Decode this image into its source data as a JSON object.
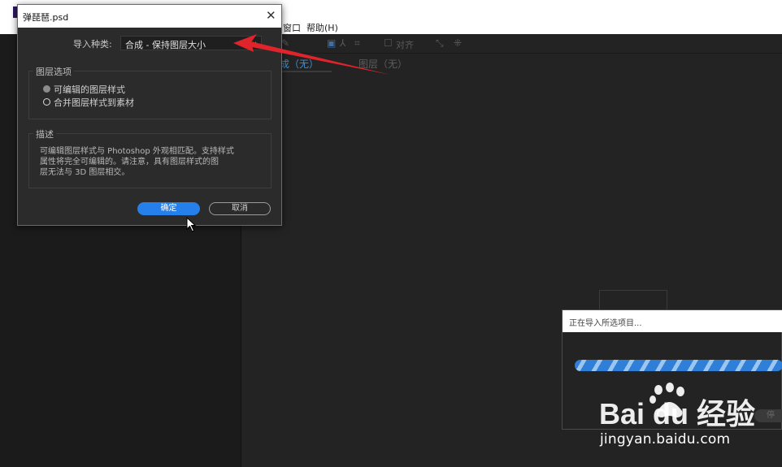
{
  "menubar": {
    "window_menu": "窗口",
    "help_menu": "帮助(H)"
  },
  "toolbar": {
    "align_label": "对齐"
  },
  "viewer_tabs": {
    "composition_tab": "成（无）",
    "layer_tab": "图层（无）"
  },
  "import_dialog": {
    "title": "弹琵琶.psd",
    "close_glyph": "✕",
    "import_kind_label": "导入种类:",
    "import_kind_value": "合成 - 保持图层大小",
    "layer_options_title": "图层选项",
    "options": [
      {
        "label": "可编辑的图层样式",
        "selected": true
      },
      {
        "label": "合并图层样式到素材",
        "selected": false
      }
    ],
    "description_title": "描述",
    "description_lines": [
      "可编辑图层样式与 Photoshop 外观相匹配。支持样式",
      "属性将完全可编辑的。请注意，具有图层样式的图",
      "层无法与 3D 图层相交。"
    ],
    "ok_label": "确定",
    "cancel_label": "取消"
  },
  "progress_dialog": {
    "title": "正在导入所选项目...",
    "stop_label": "停"
  },
  "watermark": {
    "brand": "Bai du 经验",
    "url": "jingyan.baidu.com"
  },
  "colors": {
    "accent": "#2680eb",
    "annotation_arrow": "#e0242b",
    "dialog_bg": "#2b2b2b"
  }
}
